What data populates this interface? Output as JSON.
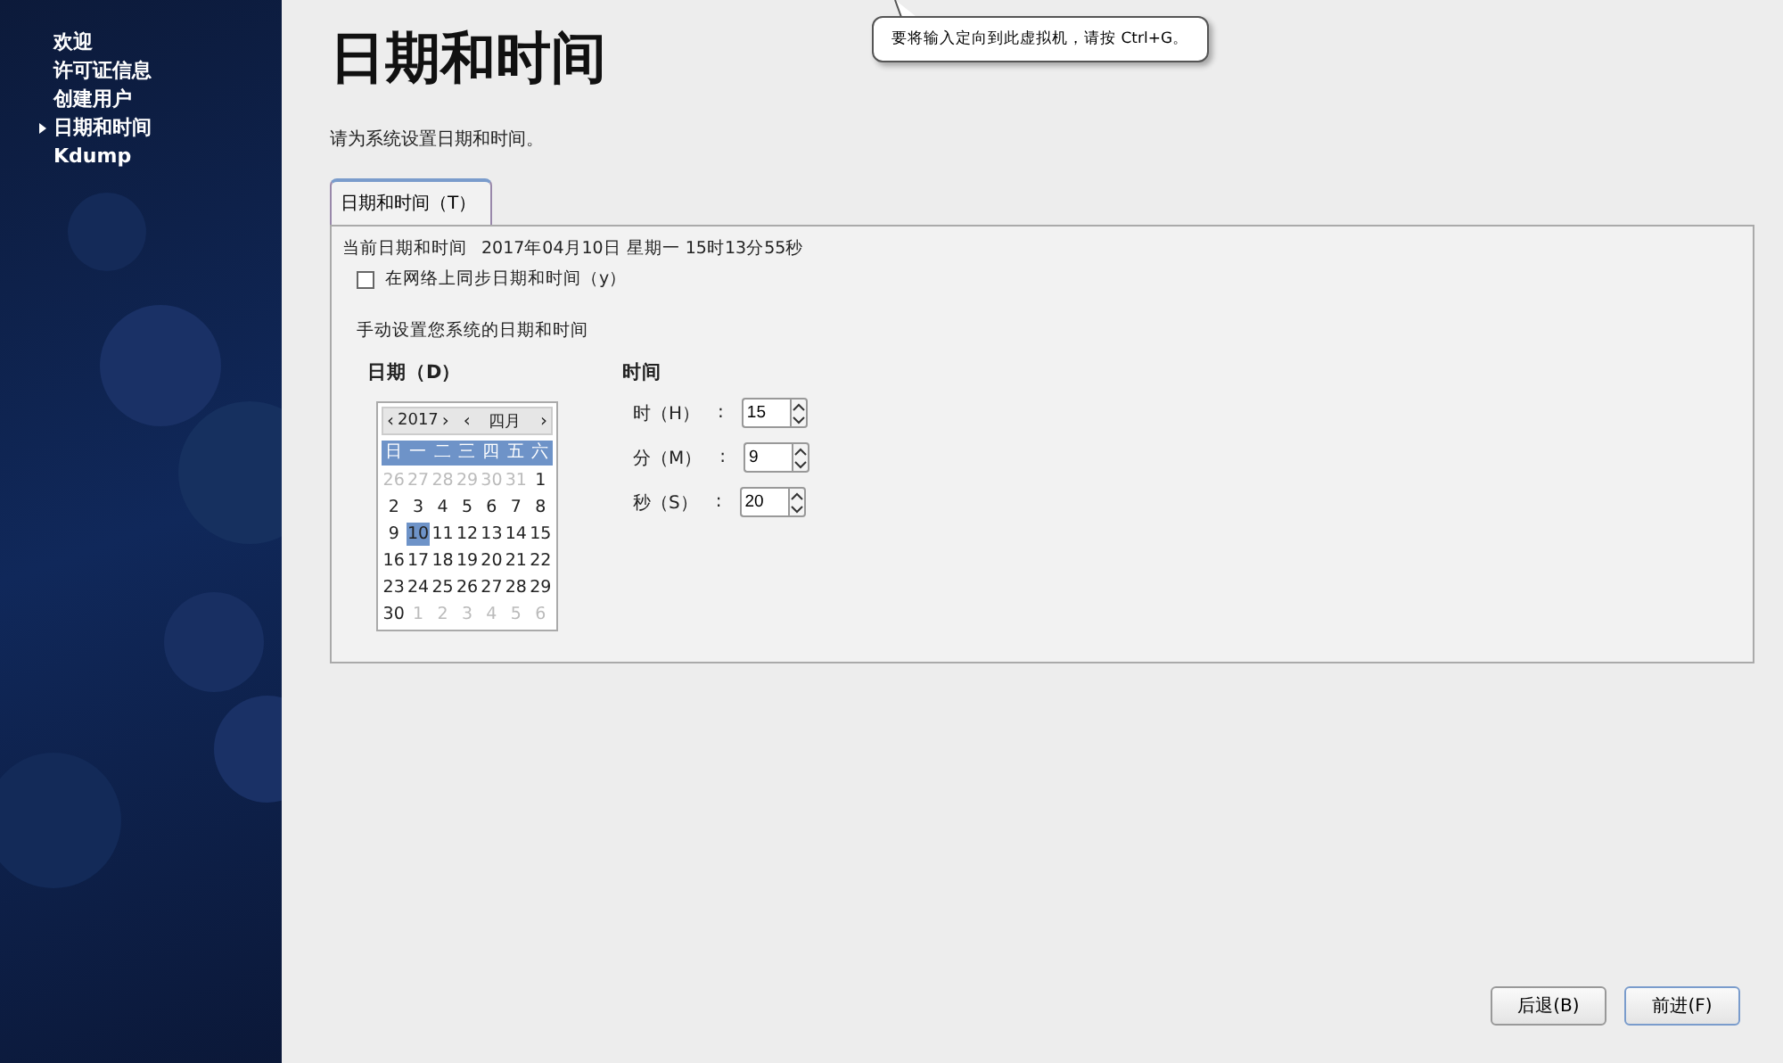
{
  "sidebar": {
    "items": [
      {
        "label": "欢迎",
        "selected": false
      },
      {
        "label": "许可证信息",
        "selected": false
      },
      {
        "label": "创建用户",
        "selected": false
      },
      {
        "label": "日期和时间",
        "selected": true
      },
      {
        "label": "Kdump",
        "selected": false
      }
    ]
  },
  "title": "日期和时间",
  "subtitle": "请为系统设置日期和时间。",
  "tooltip": "要将输入定向到此虚拟机，请按 Ctrl+G。",
  "tabs": [
    {
      "label": "日期和时间（T）",
      "selected": true
    }
  ],
  "current": {
    "label": "当前日期和时间",
    "value": "2017年04月10日  星期一  15时13分55秒"
  },
  "sync": {
    "label": "在网络上同步日期和时间（y）",
    "checked": false
  },
  "manual_label": "手动设置您系统的日期和时间",
  "date": {
    "heading": "日期（D）",
    "year": {
      "prev": "‹",
      "value": "2017",
      "next": "›"
    },
    "month": {
      "prev": "‹",
      "value": "四月",
      "next": "›"
    },
    "weekdays": [
      "日",
      "一",
      "二",
      "三",
      "四",
      "五",
      "六"
    ],
    "days": [
      {
        "day": "26",
        "muted": true,
        "selected": false
      },
      {
        "day": "27",
        "muted": true,
        "selected": false
      },
      {
        "day": "28",
        "muted": true,
        "selected": false
      },
      {
        "day": "29",
        "muted": true,
        "selected": false
      },
      {
        "day": "30",
        "muted": true,
        "selected": false
      },
      {
        "day": "31",
        "muted": true,
        "selected": false
      },
      {
        "day": "1",
        "muted": false,
        "selected": false
      },
      {
        "day": "2",
        "muted": false,
        "selected": false
      },
      {
        "day": "3",
        "muted": false,
        "selected": false
      },
      {
        "day": "4",
        "muted": false,
        "selected": false
      },
      {
        "day": "5",
        "muted": false,
        "selected": false
      },
      {
        "day": "6",
        "muted": false,
        "selected": false
      },
      {
        "day": "7",
        "muted": false,
        "selected": false
      },
      {
        "day": "8",
        "muted": false,
        "selected": false
      },
      {
        "day": "9",
        "muted": false,
        "selected": false
      },
      {
        "day": "10",
        "muted": false,
        "selected": true
      },
      {
        "day": "11",
        "muted": false,
        "selected": false
      },
      {
        "day": "12",
        "muted": false,
        "selected": false
      },
      {
        "day": "13",
        "muted": false,
        "selected": false
      },
      {
        "day": "14",
        "muted": false,
        "selected": false
      },
      {
        "day": "15",
        "muted": false,
        "selected": false
      },
      {
        "day": "16",
        "muted": false,
        "selected": false
      },
      {
        "day": "17",
        "muted": false,
        "selected": false
      },
      {
        "day": "18",
        "muted": false,
        "selected": false
      },
      {
        "day": "19",
        "muted": false,
        "selected": false
      },
      {
        "day": "20",
        "muted": false,
        "selected": false
      },
      {
        "day": "21",
        "muted": false,
        "selected": false
      },
      {
        "day": "22",
        "muted": false,
        "selected": false
      },
      {
        "day": "23",
        "muted": false,
        "selected": false
      },
      {
        "day": "24",
        "muted": false,
        "selected": false
      },
      {
        "day": "25",
        "muted": false,
        "selected": false
      },
      {
        "day": "26",
        "muted": false,
        "selected": false
      },
      {
        "day": "27",
        "muted": false,
        "selected": false
      },
      {
        "day": "28",
        "muted": false,
        "selected": false
      },
      {
        "day": "29",
        "muted": false,
        "selected": false
      },
      {
        "day": "30",
        "muted": false,
        "selected": false
      },
      {
        "day": "1",
        "muted": true,
        "selected": false
      },
      {
        "day": "2",
        "muted": true,
        "selected": false
      },
      {
        "day": "3",
        "muted": true,
        "selected": false
      },
      {
        "day": "4",
        "muted": true,
        "selected": false
      },
      {
        "day": "5",
        "muted": true,
        "selected": false
      },
      {
        "day": "6",
        "muted": true,
        "selected": false
      }
    ]
  },
  "time": {
    "heading": "时间",
    "fields": [
      {
        "label": "时（H）",
        "sep": ":",
        "value": "15"
      },
      {
        "label": "分（M）",
        "sep": ":",
        "value": "9"
      },
      {
        "label": "秒（S）",
        "sep": ":",
        "value": "20"
      }
    ]
  },
  "buttons": [
    {
      "label": "后退(B)",
      "kind": "back"
    },
    {
      "label": "前进(F)",
      "kind": "forward"
    }
  ]
}
